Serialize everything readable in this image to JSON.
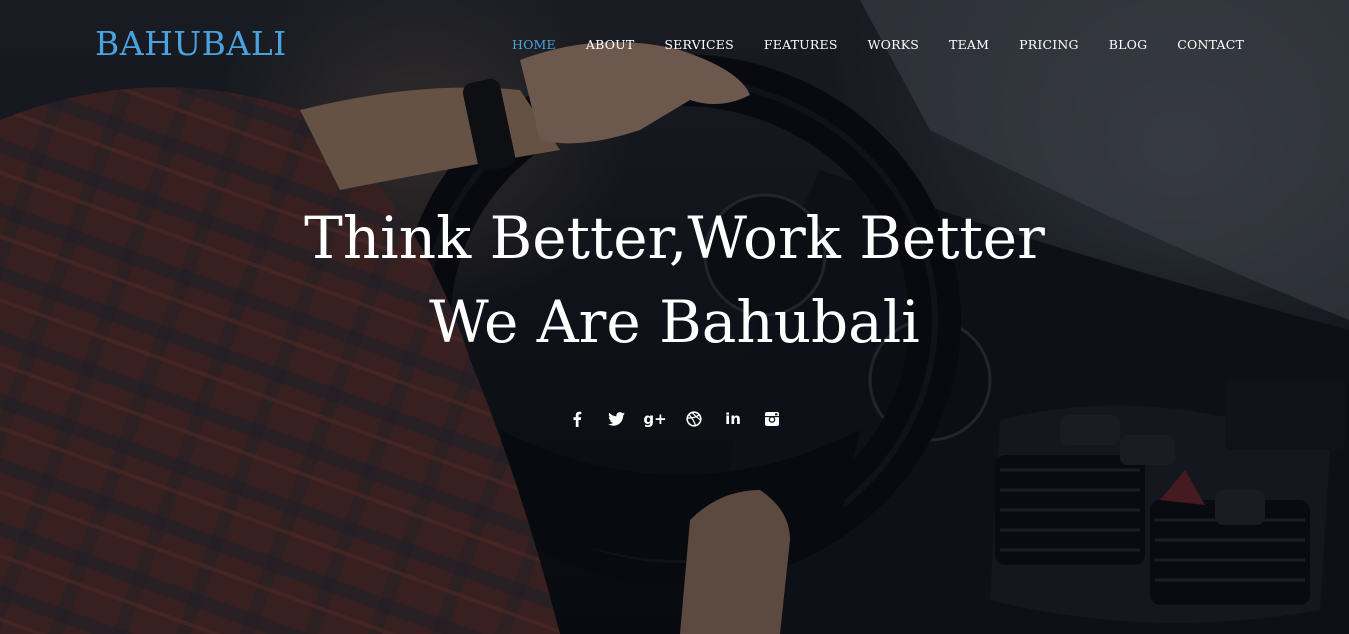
{
  "brand": {
    "logo_text": "BAHUBALI"
  },
  "nav": {
    "items": [
      {
        "label": "HOME",
        "active": true
      },
      {
        "label": "ABOUT",
        "active": false
      },
      {
        "label": "SERVICES",
        "active": false
      },
      {
        "label": "FEATURES",
        "active": false
      },
      {
        "label": "WORKS",
        "active": false
      },
      {
        "label": "TEAM",
        "active": false
      },
      {
        "label": "PRICING",
        "active": false
      },
      {
        "label": "BLOG",
        "active": false
      },
      {
        "label": "CONTACT",
        "active": false
      }
    ]
  },
  "hero": {
    "line1": "Think Better,Work Better",
    "line2": "We Are Bahubali"
  },
  "social": {
    "icons": [
      "facebook-icon",
      "twitter-icon",
      "google-plus-icon",
      "dribbble-icon",
      "linkedin-icon",
      "instagram-icon"
    ],
    "google_plus_glyph": "g+",
    "linkedin_glyph": "in"
  },
  "colors": {
    "accent": "#4aa3df",
    "text": "#ffffff"
  }
}
